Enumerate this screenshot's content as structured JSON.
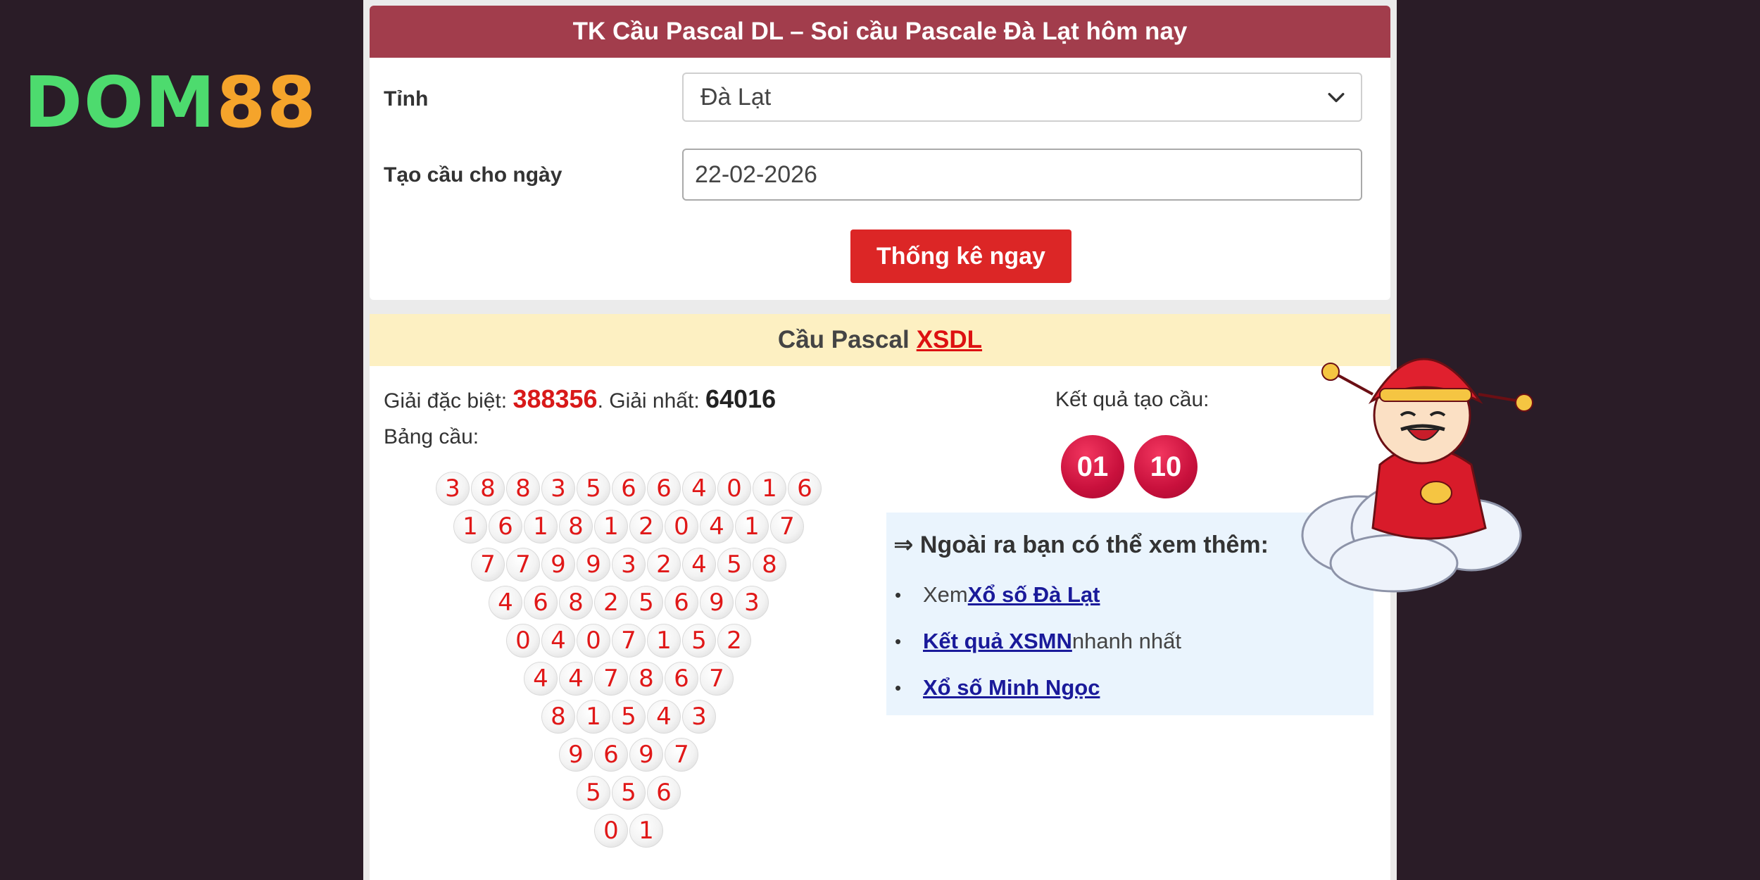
{
  "logo": {
    "part1": "DOM",
    "part2": "88"
  },
  "form": {
    "title": "TK Cầu Pascal DL – Soi cầu Pascale Đà Lạt hôm nay",
    "province_label": "Tỉnh",
    "province_value": "Đà Lạt",
    "date_label": "Tạo cầu cho ngày",
    "date_value": "22-02-2026",
    "submit_label": "Thống kê ngay"
  },
  "result": {
    "title_prefix": "Cầu Pascal",
    "title_link": "XSDL",
    "special_label": "Giải đặc biệt: ",
    "special_value": "388356",
    "first_label": ". Giải nhất: ",
    "first_value": "64016",
    "board_label": "Bảng cầu:",
    "kq_label": "Kết quả tạo cầu:",
    "kq_values": [
      "01",
      "10"
    ]
  },
  "pascal_rows": [
    [
      "3",
      "8",
      "8",
      "3",
      "5",
      "6",
      "6",
      "4",
      "0",
      "1",
      "6"
    ],
    [
      "1",
      "6",
      "1",
      "8",
      "1",
      "2",
      "0",
      "4",
      "1",
      "7"
    ],
    [
      "7",
      "7",
      "9",
      "9",
      "3",
      "2",
      "4",
      "5",
      "8"
    ],
    [
      "4",
      "6",
      "8",
      "2",
      "5",
      "6",
      "9",
      "3"
    ],
    [
      "0",
      "4",
      "0",
      "7",
      "1",
      "5",
      "2"
    ],
    [
      "4",
      "4",
      "7",
      "8",
      "6",
      "7"
    ],
    [
      "8",
      "1",
      "5",
      "4",
      "3"
    ],
    [
      "9",
      "6",
      "9",
      "7"
    ],
    [
      "5",
      "5",
      "6"
    ],
    [
      "0",
      "1"
    ]
  ],
  "more": {
    "title": "⇒ Ngoài ra bạn có thể xem thêm:",
    "items": [
      {
        "before": "Xem ",
        "link": "Xổ số Đà Lạt",
        "after": ""
      },
      {
        "before": "",
        "link": "Kết quả XSMN",
        "after": " nhanh nhất"
      },
      {
        "before": "",
        "link": "Xổ số Minh Ngọc",
        "after": ""
      }
    ]
  },
  "colors": {
    "header_bg": "#a23d4c",
    "button_bg": "#dc2626",
    "result_header_bg": "#fdf0c2",
    "result_ball": "#c8103c",
    "page_bg": "#2a1c27"
  }
}
